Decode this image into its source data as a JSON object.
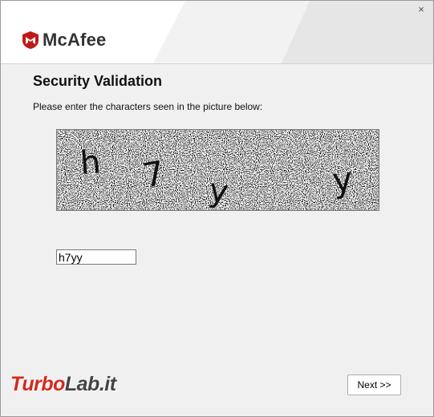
{
  "window": {
    "close_glyph": "×",
    "close_icon": "close-icon"
  },
  "brand": {
    "name": "McAfee",
    "accent": "#c01818",
    "logo_icon": "mcafee-shield-icon"
  },
  "page": {
    "title": "Security Validation",
    "instruction": "Please enter the characters seen in the picture below:"
  },
  "captcha": {
    "characters": [
      "h",
      "7",
      "y",
      "y"
    ],
    "input_value": "h7yy"
  },
  "buttons": {
    "next_label": "Next >>"
  },
  "watermark": {
    "part1": "Turbo",
    "part2": "Lab.it"
  }
}
